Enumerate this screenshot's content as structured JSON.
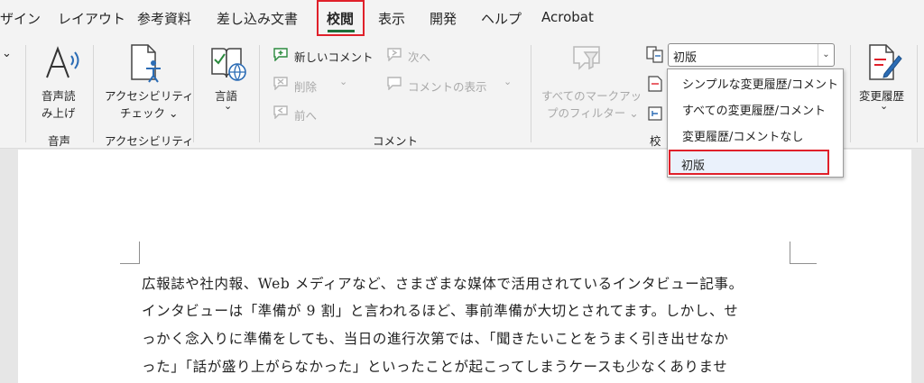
{
  "tabs": [
    {
      "label": "ザイン"
    },
    {
      "label": "レイアウト"
    },
    {
      "label": "参考資料"
    },
    {
      "label": "差し込み文書"
    },
    {
      "label": "校閲"
    },
    {
      "label": "表示"
    },
    {
      "label": "開発"
    },
    {
      "label": "ヘルプ"
    },
    {
      "label": "Acrobat"
    }
  ],
  "ribbon": {
    "speech": {
      "line1": "音声読",
      "line2": "み上げ",
      "group": "音声"
    },
    "accessibility": {
      "line1": "アクセシビリティ",
      "line2": "チェック ⌄",
      "group": "アクセシビリティ"
    },
    "language": {
      "label": "言語",
      "caret": "⌄"
    },
    "comments": {
      "new": "新しいコメント",
      "delete": "削除",
      "prev": "前へ",
      "next": "次へ",
      "show": "コメントの表示",
      "group": "コメント"
    },
    "filter": {
      "line1": "すべてのマークアッ",
      "line2": "プのフィルター ⌄"
    },
    "tracking_group_partial": "校",
    "track_changes": {
      "label": "変更履歴",
      "caret": "⌄"
    },
    "left_caret": "⌄"
  },
  "markup_dropdown": {
    "selected": "初版",
    "options": [
      "シンプルな変更履歴/コメント",
      "すべての変更履歴/コメント",
      "変更履歴/コメントなし",
      "初版"
    ]
  },
  "document": {
    "lines": [
      "広報誌や社内報、Web メディアなど、さまざまな媒体で活用されているインタビュー記事。",
      "インタビューは「準備が 9 割」と言われるほど、事前準備が大切とされてます。しかし、せ",
      "っかく念入りに準備をしても、当日の進行次第では、「聞きたいことをうまく引き出せなか",
      "った」「話が盛り上がらなかった」といったことが起こってしまうケースも少なくありませ"
    ]
  },
  "colors": {
    "highlight": "#e0202a",
    "ribbon_bg": "#f3f3f3",
    "accent_green": "#1f6f3a",
    "icon_blue": "#2b6cb5"
  }
}
